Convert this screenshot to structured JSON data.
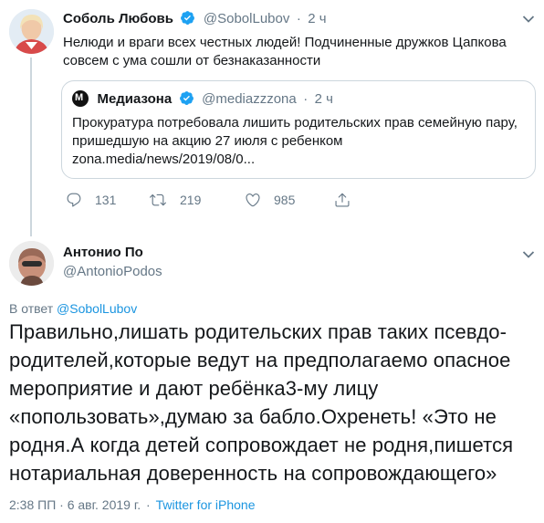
{
  "parent_tweet": {
    "author_name": "Соболь Любовь",
    "handle": "@SobolLubov",
    "separator": "·",
    "time": "2 ч",
    "text_line1": "Нелюди и враги всех честных людей! Подчиненные дружков Цапкова",
    "text_line2": "совсем с ума сошли от безнаказанности",
    "quote": {
      "author_name": "Медиазона",
      "handle": "@mediazzzona",
      "separator": "·",
      "time": "2 ч",
      "text_line1": "Прокуратура потребовала лишить родительских прав семейную пару,",
      "text_line2": "пришедшую на акцию 27 июля с ребенком",
      "text_line3": "zona.media/news/2019/08/0..."
    },
    "actions": {
      "replies": "131",
      "retweets": "219",
      "likes": "985"
    }
  },
  "main_tweet": {
    "author_name": "Антонио По",
    "handle": "@AntonioPodos",
    "reply_prefix": "В ответ",
    "reply_to": "@SobolLubov",
    "text_lines": [
      "Правильно,лишать родительских прав таких псевдо-",
      "родителей,которые ведут на предполагаемо опасное",
      "мероприятие и дают ребёнка3-му лицу",
      "«попользовать»,думаю за бабло.Охренеть! «Это не",
      "родня.А когда детей  сопровождает не родня,пишется",
      "нотариальная  доверенность на  сопровождающего»"
    ],
    "timestamp": "2:38 ПП · 6 авг. 2019 г.",
    "separator": "·",
    "source": "Twitter for iPhone"
  },
  "colors": {
    "verified": "#1da1f2",
    "muted": "#657786",
    "link": "#1b95e0",
    "border": "#ccd6dd"
  },
  "icons": [
    "reply-icon",
    "retweet-icon",
    "like-icon",
    "share-icon",
    "chevron-down-icon",
    "verified-icon"
  ]
}
